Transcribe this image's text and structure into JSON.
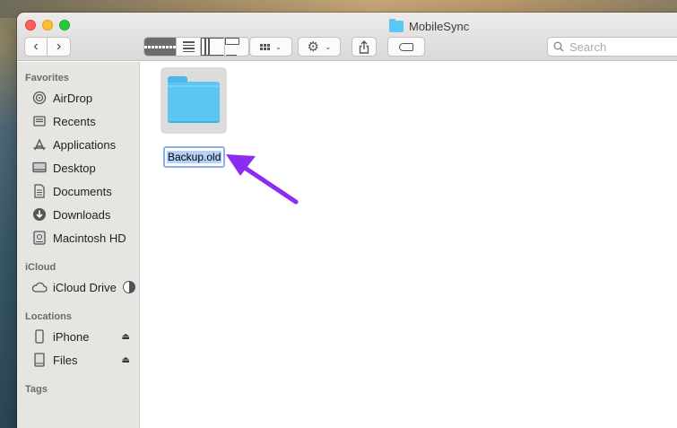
{
  "window": {
    "title": "MobileSync"
  },
  "toolbar": {
    "back_icon": "chevron-left-icon",
    "forward_icon": "chevron-right-icon",
    "share_icon": "share-icon",
    "tag_icon": "tag-icon",
    "search_placeholder": "Search"
  },
  "sidebar": {
    "sections": [
      {
        "label": "Favorites"
      },
      {
        "label": "iCloud"
      },
      {
        "label": "Locations"
      },
      {
        "label": "Tags"
      }
    ],
    "favorites": [
      {
        "label": "AirDrop",
        "icon": "airdrop-icon"
      },
      {
        "label": "Recents",
        "icon": "recents-icon"
      },
      {
        "label": "Applications",
        "icon": "applications-icon"
      },
      {
        "label": "Desktop",
        "icon": "desktop-icon"
      },
      {
        "label": "Documents",
        "icon": "documents-icon"
      },
      {
        "label": "Downloads",
        "icon": "downloads-icon"
      },
      {
        "label": "Macintosh HD",
        "icon": "hard-drive-icon"
      }
    ],
    "icloud": [
      {
        "label": "iCloud Drive",
        "icon": "cloud-icon"
      }
    ],
    "locations": [
      {
        "label": "iPhone",
        "icon": "iphone-icon"
      },
      {
        "label": "Files",
        "icon": "drive-icon"
      }
    ]
  },
  "content": {
    "items": [
      {
        "name": "Backup.old",
        "icon": "folder-icon",
        "renaming": true
      }
    ]
  },
  "colors": {
    "accent": "#8c2cf0",
    "folder": "#5cc6f2"
  }
}
